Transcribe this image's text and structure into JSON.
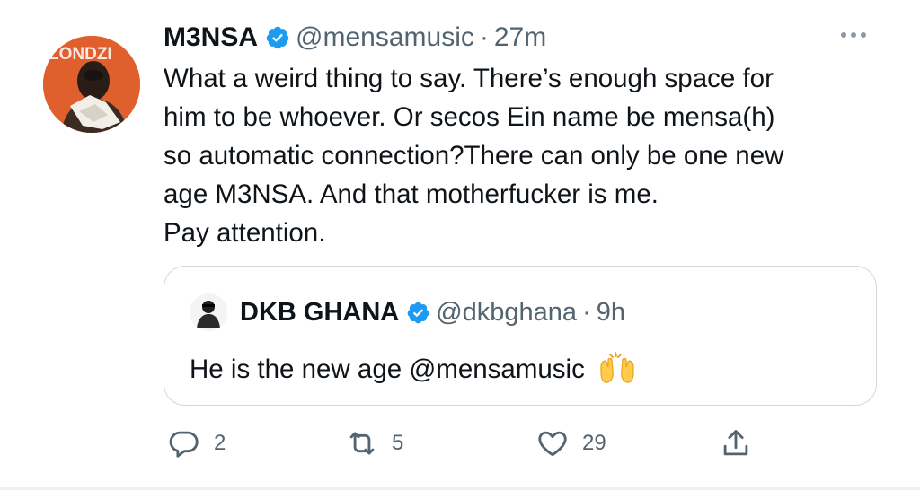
{
  "tweet": {
    "author_name": "M3NSA",
    "author_handle": "@mensamusic",
    "separator": "·",
    "time": "27m",
    "avatar_text": "LONDZI",
    "text_lines": [
      "What a weird thing to say. There’s enough space for",
      "him to be whoever. Or secos Ein name be mensa(h)",
      "so automatic connection?There can only be one new",
      "age M3NSA. And that motherfucker is me.",
      "Pay attention."
    ]
  },
  "quote": {
    "author_name": "DKB GHANA",
    "author_handle": "@dkbghana",
    "separator": "·",
    "time": "9h",
    "text": "He is the new age @mensamusic"
  },
  "actions": {
    "reply_count": "2",
    "retweet_count": "5",
    "like_count": "29"
  },
  "colors": {
    "verified": "#1d9bf0",
    "secondary_text": "#536471",
    "border": "#cfd9de",
    "avatar_bg": "#e2612e"
  },
  "icons": {
    "more": "more-dots-icon",
    "reply": "reply-icon",
    "retweet": "retweet-icon",
    "like": "heart-icon",
    "share": "share-icon",
    "verified": "verified-badge-icon",
    "emoji": "raising-hands-emoji"
  }
}
